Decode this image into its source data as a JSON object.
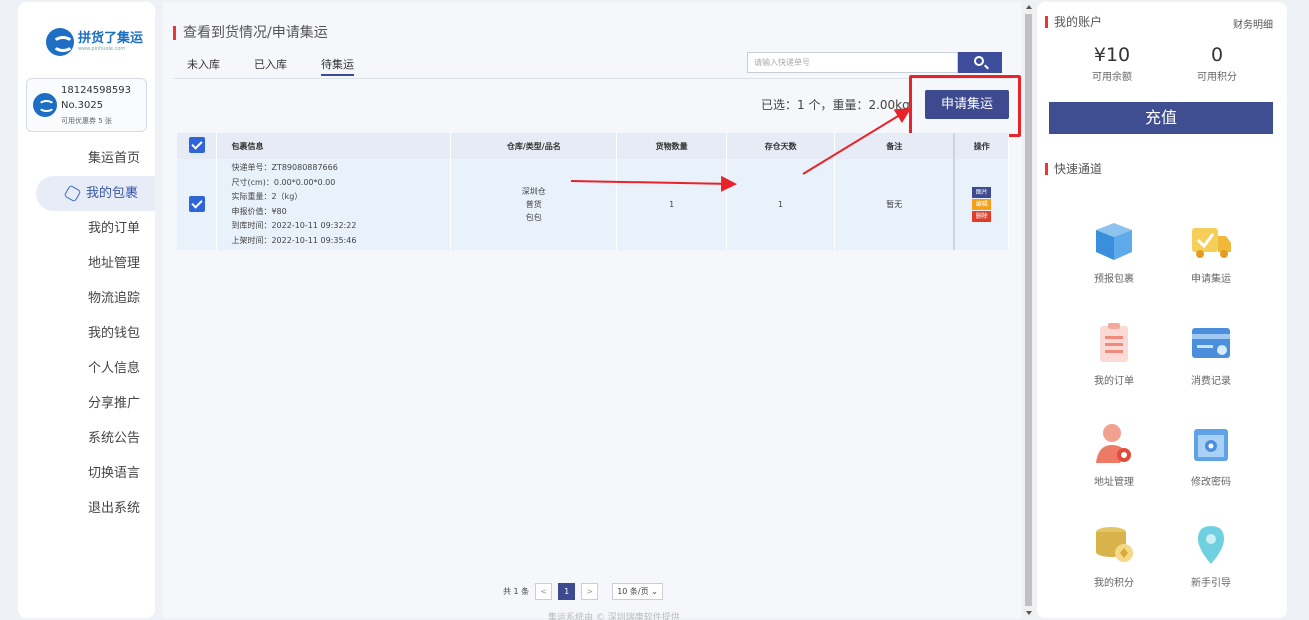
{
  "brand": {
    "name": "拼货了集运",
    "url": "www.pinhuole.com"
  },
  "user": {
    "phone": "18124598593",
    "number": "No.3025",
    "coupon": "可用优惠券 5 张"
  },
  "nav": [
    {
      "label": "集运首页"
    },
    {
      "label": "我的包裹"
    },
    {
      "label": "我的订单"
    },
    {
      "label": "地址管理"
    },
    {
      "label": "物流追踪"
    },
    {
      "label": "我的钱包"
    },
    {
      "label": "个人信息"
    },
    {
      "label": "分享推广"
    },
    {
      "label": "系统公告"
    },
    {
      "label": "切换语言"
    },
    {
      "label": "退出系统"
    }
  ],
  "main": {
    "title": "查看到货情况/申请集运",
    "tabs": [
      "未入库",
      "已入库",
      "待集运"
    ],
    "active_tab": "待集运",
    "search_placeholder": "请输入快递单号",
    "selected_info": "已选：1 个，重量：2.00kg",
    "apply_button": "申请集运",
    "table": {
      "headers": [
        "包裹信息",
        "仓库/类型/品名",
        "货物数量",
        "存仓天数",
        "备注",
        "操作"
      ],
      "rows": [
        {
          "info": [
            "快递单号：ZT89080887666",
            "尺寸(cm)：0.00*0.00*0.00",
            "实际重量：2（kg）",
            "申报价值：¥80",
            "到库时间：2022-10-11 09:32:22",
            "上架时间：2022-10-11 09:35:46"
          ],
          "warehouse": "深圳仓",
          "type": "普货",
          "name": "包包",
          "quantity": "1",
          "days": "1",
          "remark": "暂无",
          "actions": [
            "图片",
            "编辑",
            "删除"
          ]
        }
      ]
    },
    "pager": {
      "total": "共 1 条",
      "prev": "<",
      "page": "1",
      "next": ">",
      "size": "10 条/页 ⌄"
    },
    "footer": "集运系统由 © 深圳瑞康软件提供"
  },
  "account": {
    "title": "我的账户",
    "detail_link": "财务明细",
    "balance": "¥10",
    "balance_label": "可用余额",
    "points": "0",
    "points_label": "可用积分",
    "recharge": "充值"
  },
  "quick": {
    "title": "快速通道",
    "items": [
      {
        "label": "预报包裹",
        "icon": "box-icon"
      },
      {
        "label": "申请集运",
        "icon": "truck-icon"
      },
      {
        "label": "我的订单",
        "icon": "clipboard-icon"
      },
      {
        "label": "消费记录",
        "icon": "card-icon"
      },
      {
        "label": "地址管理",
        "icon": "user-location-icon"
      },
      {
        "label": "修改密码",
        "icon": "lock-icon"
      },
      {
        "label": "我的积分",
        "icon": "coins-icon"
      },
      {
        "label": "新手引导",
        "icon": "map-pin-icon"
      }
    ]
  },
  "colors": {
    "accent": "#3d4a8f",
    "highlight": "#e8232a",
    "checkbox": "#2f65d6"
  }
}
